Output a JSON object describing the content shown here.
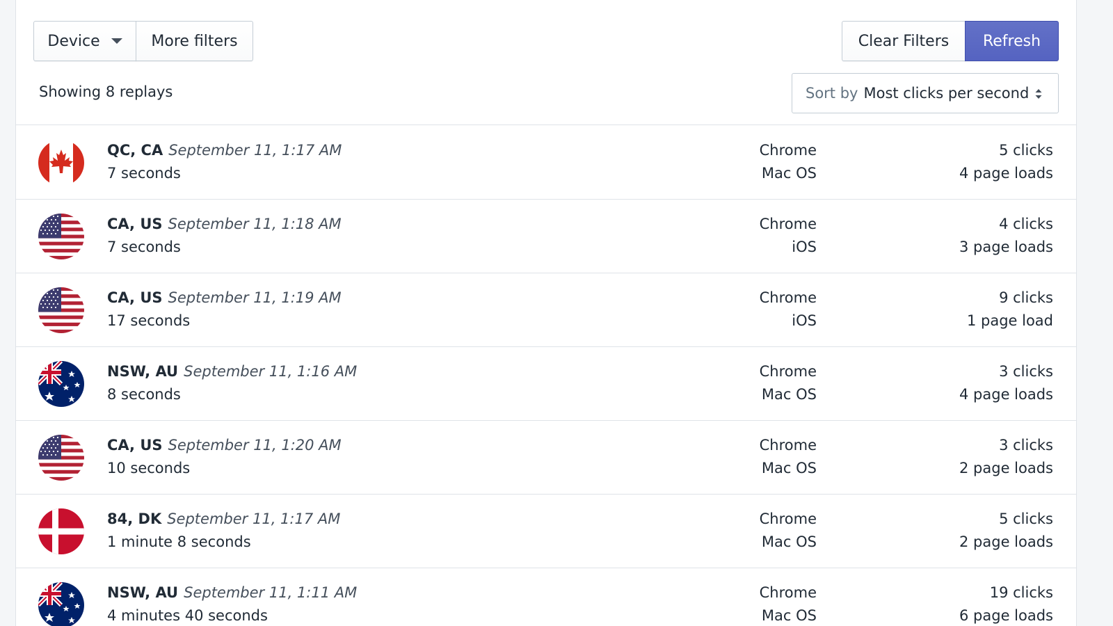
{
  "toolbar": {
    "device_label": "Device",
    "more_filters_label": "More filters",
    "clear_filters_label": "Clear Filters",
    "refresh_label": "Refresh"
  },
  "summary": {
    "showing_text": "Showing 8 replays"
  },
  "sort": {
    "label": "Sort by",
    "value": "Most clicks per second"
  },
  "colors": {
    "accent": "#5c6ac4",
    "border": "#dfe3e8",
    "text": "#212b36"
  },
  "replays": [
    {
      "flag": "canada-flag-icon",
      "region": "QC, CA",
      "date": "September 11, 1:17 AM",
      "duration": "7 seconds",
      "browser": "Chrome",
      "os": "Mac OS",
      "clicks": "5 clicks",
      "page_loads": "4 page loads"
    },
    {
      "flag": "usa-flag-icon",
      "region": "CA, US",
      "date": "September 11, 1:18 AM",
      "duration": "7 seconds",
      "browser": "Chrome",
      "os": "iOS",
      "clicks": "4 clicks",
      "page_loads": "3 page loads"
    },
    {
      "flag": "usa-flag-icon",
      "region": "CA, US",
      "date": "September 11, 1:19 AM",
      "duration": "17 seconds",
      "browser": "Chrome",
      "os": "iOS",
      "clicks": "9 clicks",
      "page_loads": "1 page load"
    },
    {
      "flag": "australia-flag-icon",
      "region": "NSW, AU",
      "date": "September 11, 1:16 AM",
      "duration": "8 seconds",
      "browser": "Chrome",
      "os": "Mac OS",
      "clicks": "3 clicks",
      "page_loads": "4 page loads"
    },
    {
      "flag": "usa-flag-icon",
      "region": "CA, US",
      "date": "September 11, 1:20 AM",
      "duration": "10 seconds",
      "browser": "Chrome",
      "os": "Mac OS",
      "clicks": "3 clicks",
      "page_loads": "2 page loads"
    },
    {
      "flag": "denmark-flag-icon",
      "region": "84, DK",
      "date": "September 11, 1:17 AM",
      "duration": "1 minute 8 seconds",
      "browser": "Chrome",
      "os": "Mac OS",
      "clicks": "5 clicks",
      "page_loads": "2 page loads"
    },
    {
      "flag": "australia-flag-icon",
      "region": "NSW, AU",
      "date": "September 11, 1:11 AM",
      "duration": "4 minutes 40 seconds",
      "browser": "Chrome",
      "os": "Mac OS",
      "clicks": "19 clicks",
      "page_loads": "6 page loads"
    }
  ]
}
